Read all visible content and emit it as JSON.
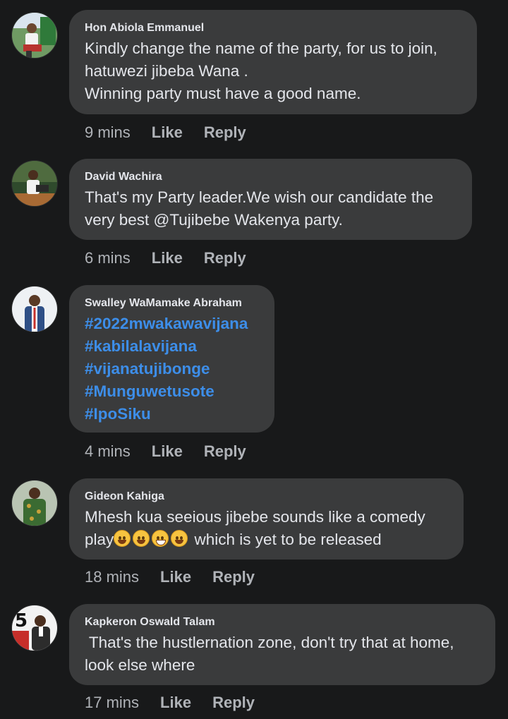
{
  "comments": [
    {
      "author": "Hon Abiola Emmanuel",
      "lines": [
        "Kindly change the name of the party, for us to join,",
        "hatuwezi jibeba Wana .",
        "Winning party must have a good name."
      ],
      "time": "9 mins",
      "like": "Like",
      "reply": "Reply"
    },
    {
      "author": "David Wachira",
      "lines": [
        "That's my Party leader.We wish our candidate the",
        "very best @Tujibebe Wakenya party."
      ],
      "time": "6 mins",
      "like": "Like",
      "reply": "Reply"
    },
    {
      "author": "Swalley WaMamake Abraham",
      "hashtags": [
        "#2022mwakawavijana",
        "#kabilalavijana",
        "#vijanatujibonge",
        "#Munguwetusote",
        "#IpoSiku"
      ],
      "time": "4 mins",
      "like": "Like",
      "reply": "Reply"
    },
    {
      "author": "Gideon Kahiga",
      "lines": [
        "Mhesh kua seeious jibebe sounds like a comedy",
        "play",
        " which is yet to be released"
      ],
      "time": "18 mins",
      "like": "Like",
      "reply": "Reply"
    },
    {
      "author": "Kapkeron Oswald Talam",
      "lines": [
        " That's the hustlernation zone, don't try that at home,",
        "look else where"
      ],
      "time": "17 mins",
      "like": "Like",
      "reply": "Reply"
    }
  ],
  "colors": {
    "background": "#18191a",
    "bubble": "#3a3b3c",
    "text": "#e4e6eb",
    "secondary": "#b0b3b8",
    "hashtag": "#3d8ee9"
  }
}
